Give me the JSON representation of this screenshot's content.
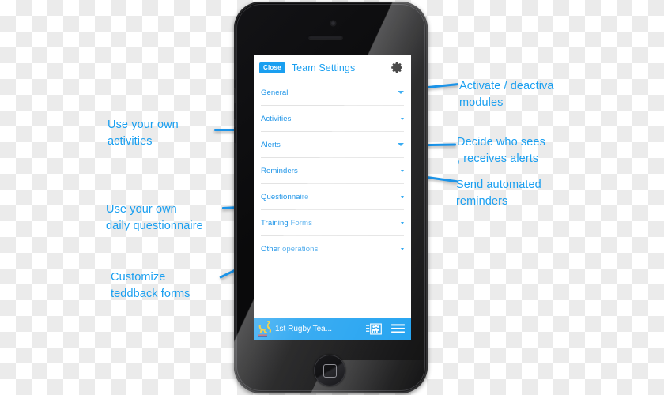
{
  "device": {
    "type": "smartphone",
    "icons": {
      "camera": "camera-dot",
      "speaker": "earpiece-speaker",
      "home": "home-button"
    }
  },
  "screen": {
    "header": {
      "close_label": "Close",
      "title": "Team Settings",
      "gear_icon": "gear-icon"
    },
    "settings_rows": [
      {
        "label": "General",
        "caret": "chevron-down-icon"
      },
      {
        "label": "Activities",
        "caret": "chevron-down-icon"
      },
      {
        "label": "Alerts",
        "caret": "chevron-down-icon"
      },
      {
        "label": "Reminders",
        "caret": "chevron-down-icon"
      },
      {
        "label": "Questionnaire",
        "caret": "chevron-down-icon"
      },
      {
        "label": "Training Forms",
        "caret": "chevron-down-icon"
      },
      {
        "label": "Other operations",
        "caret": "chevron-down-icon"
      }
    ],
    "bottom_bar": {
      "logo_icon": "kangaroo-logo-icon",
      "team_name": "1st Rugby Tea...",
      "people_icon": "people-group-icon",
      "menu_icon": "hamburger-menu-icon"
    }
  },
  "annotations": {
    "left": [
      {
        "id": "use-your-own-activities",
        "text": "Use your own\nactivities"
      },
      {
        "id": "use-your-own-daily-questionnaire",
        "text": "Use your own\ndaily questionnaire"
      },
      {
        "id": "customize-teddback-forms",
        "text": "Customize\n teddback forms"
      }
    ],
    "right": [
      {
        "id": "activate-deactivate-modules",
        "text": "Activate / deactiva\nmodules"
      },
      {
        "id": "decide-who-sees-alerts",
        "text": "Decide who sees\n, receives alerts"
      },
      {
        "id": "send-automated-reminders",
        "text": "Send automated\nreminders"
      }
    ]
  },
  "colors": {
    "accent": "#1a9ff0",
    "annotation": "#1a93e8",
    "label": "#2196e8",
    "device_body": "#0c0c0d",
    "screen_bg": "#ffffff",
    "divider": "#e3e3e3",
    "checker_light": "#ffffff",
    "checker_dark": "#ebebeb"
  }
}
